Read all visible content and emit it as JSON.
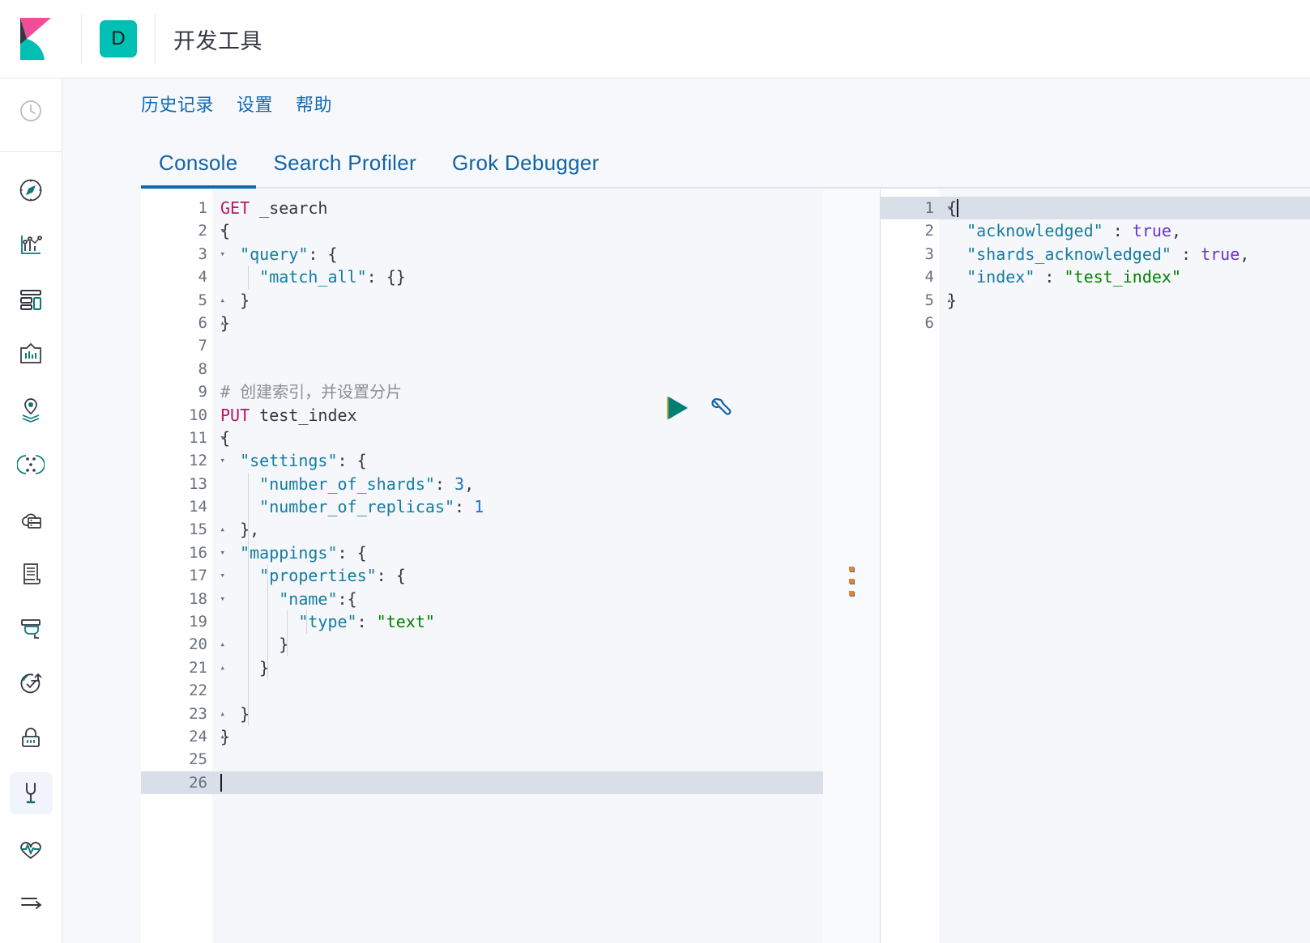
{
  "header": {
    "logo_icon": "kibana-logo",
    "space_badge": "D",
    "title": "开发工具"
  },
  "menu": {
    "items": [
      {
        "label": "历史记录",
        "name": "history"
      },
      {
        "label": "设置",
        "name": "settings"
      },
      {
        "label": "帮助",
        "name": "help"
      }
    ]
  },
  "tabs": [
    {
      "label": "Console",
      "name": "console",
      "active": true
    },
    {
      "label": "Search Profiler",
      "name": "search-profiler",
      "active": false
    },
    {
      "label": "Grok Debugger",
      "name": "grok-debugger",
      "active": false
    }
  ],
  "sidebar": {
    "items": [
      {
        "name": "recently-viewed-icon",
        "icon": "clock"
      },
      {
        "name": "discover-icon",
        "icon": "compass"
      },
      {
        "name": "visualize-icon",
        "icon": "chart"
      },
      {
        "name": "dashboard-icon",
        "icon": "dashboard"
      },
      {
        "name": "canvas-icon",
        "icon": "canvas"
      },
      {
        "name": "maps-icon",
        "icon": "map-pin-layers"
      },
      {
        "name": "machine-learning-icon",
        "icon": "ml-nodes"
      },
      {
        "name": "infrastructure-icon",
        "icon": "cloud-server"
      },
      {
        "name": "logs-icon",
        "icon": "scroll"
      },
      {
        "name": "apm-icon",
        "icon": "apm-trace"
      },
      {
        "name": "uptime-icon",
        "icon": "uptime-check"
      },
      {
        "name": "security-icon",
        "icon": "lock"
      },
      {
        "name": "dev-tools-icon",
        "icon": "wrench",
        "selected": true
      },
      {
        "name": "monitoring-icon",
        "icon": "heart-pulse"
      },
      {
        "name": "collapse-nav-icon",
        "icon": "arrow-right-lines"
      }
    ]
  },
  "console": {
    "actions": {
      "play_label": "send-request",
      "wrench_label": "request-options"
    },
    "request_editor": {
      "name": "request-editor",
      "total_lines": 26,
      "active_line": 26,
      "lines": [
        {
          "n": 1,
          "fold": "",
          "tokens": [
            {
              "t": "GET",
              "c": "kw"
            },
            {
              "t": " _search",
              "c": "plain"
            }
          ]
        },
        {
          "n": 2,
          "fold": "▾",
          "tokens": [
            {
              "t": "{",
              "c": "plain"
            }
          ]
        },
        {
          "n": 3,
          "fold": "▾",
          "tokens": [
            {
              "t": "  ",
              "c": "plain"
            },
            {
              "t": "\"query\"",
              "c": "key"
            },
            {
              "t": ": {",
              "c": "plain"
            }
          ]
        },
        {
          "n": 4,
          "fold": "",
          "tokens": [
            {
              "t": "    ",
              "c": "plain"
            },
            {
              "t": "\"match_all\"",
              "c": "key"
            },
            {
              "t": ": {}",
              "c": "plain"
            }
          ]
        },
        {
          "n": 5,
          "fold": "▴",
          "tokens": [
            {
              "t": "  }",
              "c": "plain"
            }
          ]
        },
        {
          "n": 6,
          "fold": "▴",
          "tokens": [
            {
              "t": "}",
              "c": "plain"
            }
          ]
        },
        {
          "n": 7,
          "fold": "",
          "tokens": []
        },
        {
          "n": 8,
          "fold": "",
          "tokens": []
        },
        {
          "n": 9,
          "fold": "",
          "tokens": [
            {
              "t": "# 创建索引，并设置分片",
              "c": "cmt"
            }
          ]
        },
        {
          "n": 10,
          "fold": "",
          "tokens": [
            {
              "t": "PUT",
              "c": "kw"
            },
            {
              "t": " test_index",
              "c": "plain"
            }
          ]
        },
        {
          "n": 11,
          "fold": "▾",
          "tokens": [
            {
              "t": "{",
              "c": "plain"
            }
          ]
        },
        {
          "n": 12,
          "fold": "▾",
          "tokens": [
            {
              "t": "  ",
              "c": "plain"
            },
            {
              "t": "\"settings\"",
              "c": "key"
            },
            {
              "t": ": {",
              "c": "plain"
            }
          ]
        },
        {
          "n": 13,
          "fold": "",
          "tokens": [
            {
              "t": "    ",
              "c": "plain"
            },
            {
              "t": "\"number_of_shards\"",
              "c": "key"
            },
            {
              "t": ": ",
              "c": "plain"
            },
            {
              "t": "3",
              "c": "num"
            },
            {
              "t": ",",
              "c": "plain"
            }
          ]
        },
        {
          "n": 14,
          "fold": "",
          "tokens": [
            {
              "t": "    ",
              "c": "plain"
            },
            {
              "t": "\"number_of_replicas\"",
              "c": "key"
            },
            {
              "t": ": ",
              "c": "plain"
            },
            {
              "t": "1",
              "c": "num"
            }
          ]
        },
        {
          "n": 15,
          "fold": "▴",
          "tokens": [
            {
              "t": "  },",
              "c": "plain"
            }
          ]
        },
        {
          "n": 16,
          "fold": "▾",
          "tokens": [
            {
              "t": "  ",
              "c": "plain"
            },
            {
              "t": "\"mappings\"",
              "c": "key"
            },
            {
              "t": ": {",
              "c": "plain"
            }
          ]
        },
        {
          "n": 17,
          "fold": "▾",
          "tokens": [
            {
              "t": "    ",
              "c": "plain"
            },
            {
              "t": "\"properties\"",
              "c": "key"
            },
            {
              "t": ": {",
              "c": "plain"
            }
          ]
        },
        {
          "n": 18,
          "fold": "▾",
          "tokens": [
            {
              "t": "      ",
              "c": "plain"
            },
            {
              "t": "\"name\"",
              "c": "key"
            },
            {
              "t": ":{",
              "c": "plain"
            }
          ]
        },
        {
          "n": 19,
          "fold": "",
          "tokens": [
            {
              "t": "        ",
              "c": "plain"
            },
            {
              "t": "\"type\"",
              "c": "key"
            },
            {
              "t": ": ",
              "c": "plain"
            },
            {
              "t": "\"text\"",
              "c": "str"
            }
          ]
        },
        {
          "n": 20,
          "fold": "▴",
          "tokens": [
            {
              "t": "      }",
              "c": "plain"
            }
          ]
        },
        {
          "n": 21,
          "fold": "▴",
          "tokens": [
            {
              "t": "    }",
              "c": "plain"
            }
          ]
        },
        {
          "n": 22,
          "fold": "",
          "tokens": []
        },
        {
          "n": 23,
          "fold": "▴",
          "tokens": [
            {
              "t": "  }",
              "c": "plain"
            }
          ]
        },
        {
          "n": 24,
          "fold": "▴",
          "tokens": [
            {
              "t": "}",
              "c": "plain"
            }
          ]
        },
        {
          "n": 25,
          "fold": "",
          "tokens": []
        },
        {
          "n": 26,
          "fold": "",
          "tokens": [],
          "caret": true
        }
      ]
    },
    "response_editor": {
      "name": "response-editor",
      "total_lines": 6,
      "highlighted_line": 1,
      "lines": [
        {
          "n": 1,
          "fold": "▾",
          "tokens": [
            {
              "t": "{",
              "c": "plain"
            }
          ],
          "caret": true
        },
        {
          "n": 2,
          "fold": "",
          "tokens": [
            {
              "t": "  ",
              "c": "plain"
            },
            {
              "t": "\"acknowledged\"",
              "c": "key"
            },
            {
              "t": " : ",
              "c": "plain"
            },
            {
              "t": "true",
              "c": "bool"
            },
            {
              "t": ",",
              "c": "plain"
            }
          ]
        },
        {
          "n": 3,
          "fold": "",
          "tokens": [
            {
              "t": "  ",
              "c": "plain"
            },
            {
              "t": "\"shards_acknowledged\"",
              "c": "key"
            },
            {
              "t": " : ",
              "c": "plain"
            },
            {
              "t": "true",
              "c": "bool"
            },
            {
              "t": ",",
              "c": "plain"
            }
          ]
        },
        {
          "n": 4,
          "fold": "",
          "tokens": [
            {
              "t": "  ",
              "c": "plain"
            },
            {
              "t": "\"index\"",
              "c": "key"
            },
            {
              "t": " : ",
              "c": "plain"
            },
            {
              "t": "\"test_index\"",
              "c": "str"
            }
          ]
        },
        {
          "n": 5,
          "fold": "▴",
          "tokens": [
            {
              "t": "}",
              "c": "plain"
            }
          ]
        },
        {
          "n": 6,
          "fold": "",
          "tokens": []
        }
      ]
    },
    "splitter": {
      "name": "pane-splitter",
      "grip_dots": 3
    }
  },
  "colors": {
    "brand_teal": "#00BFB3",
    "brand_pink": "#F04E98",
    "link_blue": "#0f6ab4",
    "tab_active": "#0a6cb8",
    "keyword": "#b0186a",
    "json_key": "#137ca0",
    "string": "#008000",
    "boolean": "#6b2fd6",
    "number": "#1f6fc2",
    "comment": "#8a8f98",
    "editor_bg": "#f5f7fa",
    "active_line": "#d9dfe9"
  }
}
